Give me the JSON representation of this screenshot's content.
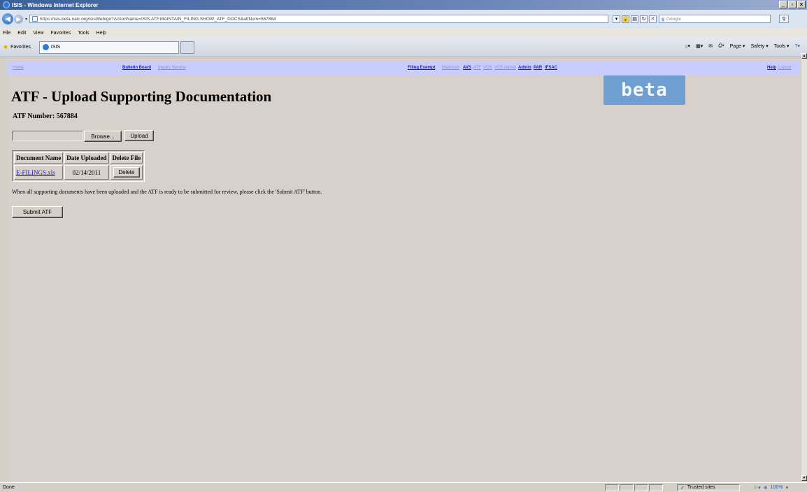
{
  "window": {
    "title": "ISIS - Windows Internet Explorer",
    "controls": [
      "_",
      "̄",
      "×"
    ]
  },
  "address": {
    "url": "https://isis-beta.naic.org/isisWeb/go?ActionName=ISIS.ATF.MAINTAIN_FILING.SHOW_ATF_DOCS&atfNum=567884",
    "search_placeholder": "Google"
  },
  "menu": [
    "File",
    "Edit",
    "View",
    "Favorites",
    "Tools",
    "Help"
  ],
  "favorites": {
    "label": "Favorites",
    "tab_title": "ISIS"
  },
  "command_bar": [
    "Page ▾",
    "Safety ▾",
    "Tools ▾"
  ],
  "site_nav": {
    "home": "Home",
    "bulletin_board": "Bulletin Board",
    "inquiry_service": "Inquiry Service",
    "filing_exempt": "Filing Exempt",
    "mailroom": "Mailroom",
    "avs": "AVS",
    "atf": "ATF",
    "vos": "VOS",
    "vos_admin": "VOS Admin",
    "admin": "Admin",
    "par": "PAR",
    "ifsac": "IFSAC",
    "help": "Help",
    "logout": "Logout"
  },
  "page": {
    "title": "ATF - Upload Supporting Documentation",
    "beta_badge": "beta",
    "atf_number_label": "ATF Number: 567884",
    "browse_label": "Browse...",
    "upload_label": "Upload",
    "table": {
      "headers": [
        "Document Name",
        "Date Uploaded",
        "Delete File"
      ],
      "rows": [
        {
          "name": "E-FILINGS.xls",
          "date": "02/14/2011",
          "action": "Delete"
        }
      ]
    },
    "instructions": "When all supporting documents have been uploaded and the ATF is ready to be submitted for review, please click the 'Submit ATF' button.",
    "submit_label": "Submit ATF"
  },
  "status": {
    "text": "Done",
    "zone": "Trusted sites",
    "zoom": "100%"
  }
}
